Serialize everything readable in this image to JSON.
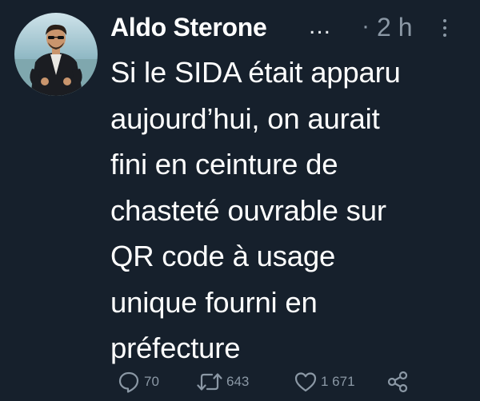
{
  "author": {
    "name": "Aldo Sterone",
    "ellipsis": "...",
    "separator": "·",
    "time": "2 h"
  },
  "tweet": {
    "text": "Si le SIDA était apparu\naujourd’hui, on aurait\nfini en ceinture de\nchasteté ouvrable sur\nQR code à usage\nunique fourni en\npréfecture"
  },
  "actions": {
    "replies": "70",
    "retweets": "643",
    "likes": "1 671"
  },
  "icons": {
    "reply": "reply-icon",
    "retweet": "retweet-icon",
    "like": "heart-icon",
    "share": "share-icon",
    "more": "more-vertical-icon"
  },
  "colors": {
    "background": "#16202c",
    "text": "#ffffff",
    "muted": "#8b98a5"
  }
}
